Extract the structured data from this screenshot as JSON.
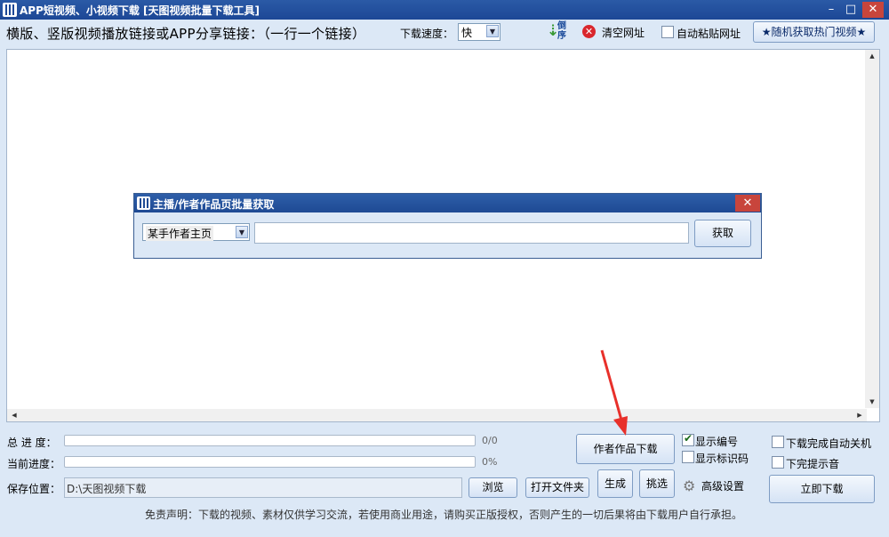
{
  "window": {
    "title": "APP短视频、小视频下载 [天图视频批量下载工具]",
    "minimize_glyph": "–",
    "maximize_glyph": "□",
    "close_glyph": "✕"
  },
  "toolbar": {
    "instruction": "横版、竖版视频播放链接或APP分享链接：（一行一个链接）",
    "speed_label": "下载速度：",
    "speed_value": "快",
    "reverse_label": "倒序",
    "clear_label": "清空网址",
    "auto_paste_label": "自动粘贴网址",
    "auto_paste_checked": false,
    "hot_button_label": "★随机获取热门视频★"
  },
  "links_area": {
    "content": ""
  },
  "batch_modal": {
    "title": "主播/作者作品页批量获取",
    "source_selected": "某手作者主页",
    "url_value": "",
    "fetch_label": "获取",
    "close_glyph": "✕"
  },
  "bottom": {
    "total_progress_label": "总 进 度：",
    "total_progress_text": "0/0",
    "total_progress_value": 0,
    "current_progress_label": "当前进度：",
    "current_progress_text": "0%",
    "current_progress_value": 0,
    "save_label": "保存位置：",
    "save_path": "D:\\天图视频下载",
    "browse_label": "浏览",
    "open_folder_label": "打开文件夹",
    "author_download_label": "作者作品下载",
    "generate_label": "生成",
    "pick_label": "挑选",
    "show_number_label": "显示编号",
    "show_number_checked": true,
    "show_id_label": "显示标识码",
    "show_id_checked": false,
    "shutdown_label": "下载完成自动关机",
    "shutdown_checked": false,
    "sound_label": "下完提示音",
    "sound_checked": false,
    "advanced_label": "高级设置",
    "download_now_label": "立即下载",
    "disclaimer": "免责声明：下载的视频、素材仅供学习交流，若使用商业用途，请购买正版授权，否则产生的一切后果将由下载用户自行承担。"
  },
  "colors": {
    "title_bar": "#1c4796",
    "close_red": "#c8453c",
    "annotation_arrow": "#e8302a"
  }
}
